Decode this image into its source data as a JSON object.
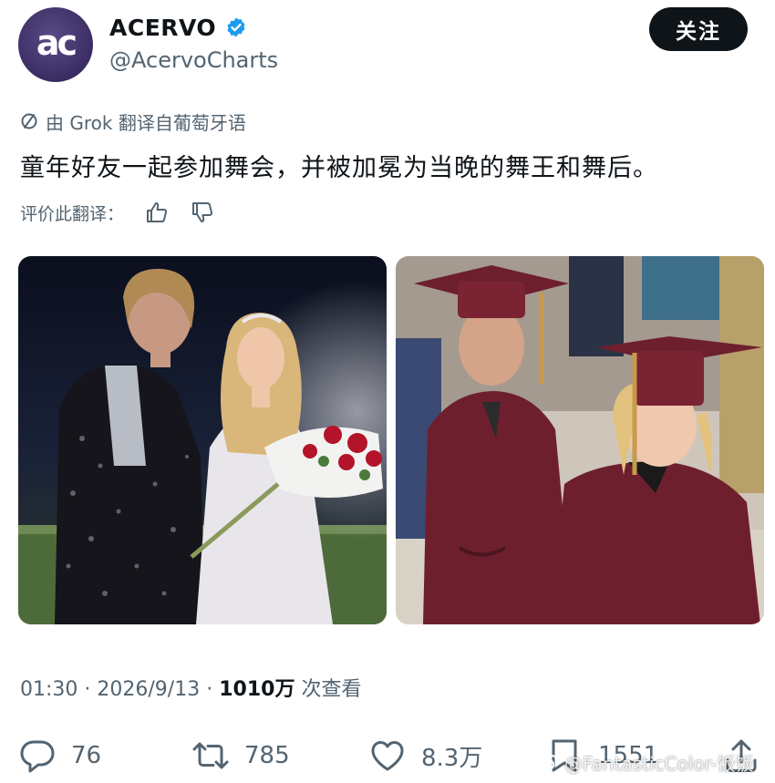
{
  "header": {
    "avatar_logo": "ac",
    "display_name": "ACERVO",
    "handle": "@AcervoCharts",
    "follow_label": "关注"
  },
  "translation": {
    "note": "由 Grok 翻译自葡萄牙语",
    "text": "童年好友一起参加舞会，并被加冕为当晚的舞王和舞后。",
    "rate_label": "评价此翻译："
  },
  "meta": {
    "time": "01:30",
    "date": "2026/9/13",
    "views": "1010万",
    "views_suffix": "次查看"
  },
  "actions": {
    "replies": "76",
    "reposts": "785",
    "likes": "8.3万",
    "bookmarks": "1551"
  },
  "watermark": "@FantasticColor-饭饭",
  "colors": {
    "accent": "#1d9bf0",
    "text": "#0f1419",
    "muted": "#536471",
    "avatar": "#3b2d63",
    "gown": "#6e1f2e"
  }
}
